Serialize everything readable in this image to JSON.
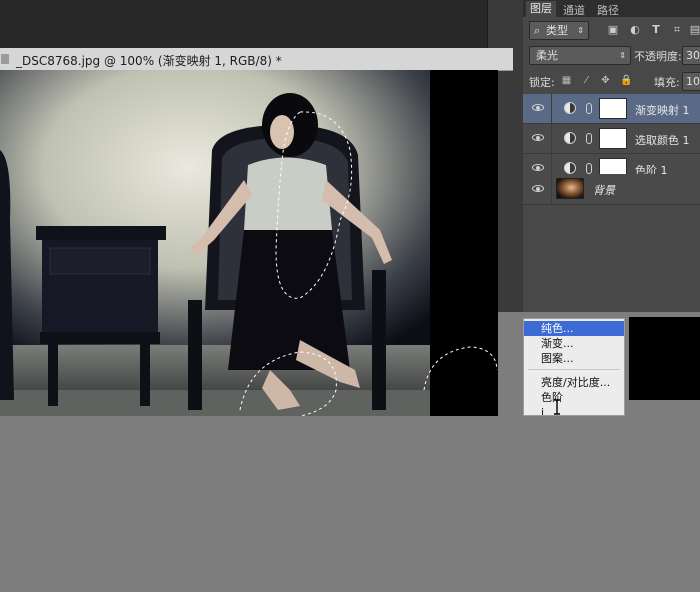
{
  "document": {
    "title": "_DSC8768.jpg @ 100% (渐变映射 1, RGB/8) *"
  },
  "panel_tabs": [
    "图层",
    "通道",
    "路径"
  ],
  "filter": {
    "kind_label": "类型"
  },
  "blend": {
    "mode": "柔光",
    "opacity_label": "不透明度:",
    "opacity_value": "30",
    "lock_label": "锁定:",
    "fill_label": "填充:",
    "fill_value": "10"
  },
  "layers": [
    {
      "name": "渐变映射 1",
      "selected": true
    },
    {
      "name": "选取颜色 1",
      "selected": false
    },
    {
      "name": "色阶 1",
      "selected": false
    }
  ],
  "background_layer": {
    "name": "背景"
  },
  "adjust_menu": {
    "items": [
      "纯色...",
      "渐变...",
      "图案...",
      "亮度/对比度...",
      "色阶",
      "i"
    ],
    "highlighted_index": 0
  },
  "icons": {
    "search": "search-icon",
    "image_filter": "image-filter-icon",
    "adjust_filter": "adjustment-filter-icon",
    "type_filter": "type-filter-icon",
    "shape_filter": "shape-filter-icon",
    "smart_filter": "smart-object-filter-icon"
  },
  "colors": {
    "selected_layer": "#5a6a86",
    "menu_highlight": "#3d6bd6",
    "panel_bg": "#484848"
  }
}
